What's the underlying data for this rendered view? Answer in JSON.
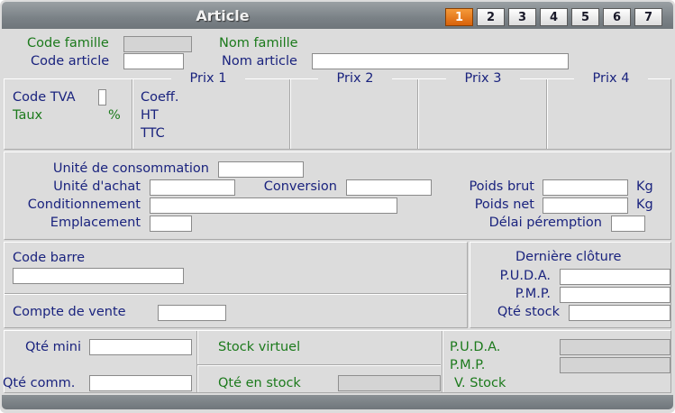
{
  "window": {
    "title": "Article"
  },
  "tabs": [
    "1",
    "2",
    "3",
    "4",
    "5",
    "6",
    "7"
  ],
  "header": {
    "code_famille": "Code famille",
    "nom_famille": "Nom famille",
    "code_article": "Code article",
    "nom_article": "Nom article"
  },
  "prix": {
    "headers": [
      "Prix 1",
      "Prix 2",
      "Prix 3",
      "Prix 4"
    ],
    "code_tva": "Code TVA",
    "taux": "Taux",
    "percent": "%",
    "coeff": "Coeff.",
    "ht": "HT",
    "ttc": "TTC"
  },
  "units": {
    "unite_consommation": "Unité de consommation",
    "unite_achat": "Unité d'achat",
    "conversion": "Conversion",
    "poids_brut": "Poids brut",
    "kg1": "Kg",
    "conditionnement": "Conditionnement",
    "poids_net": "Poids net",
    "kg2": "Kg",
    "emplacement": "Emplacement",
    "delai_peremption": "Délai péremption"
  },
  "codebarre": {
    "label": "Code barre",
    "compte_vente": "Compte de vente"
  },
  "cloture": {
    "title": "Dernière clôture",
    "puda": "P.U.D.A.",
    "pmp": "P.M.P.",
    "qte_stock": "Qté stock"
  },
  "stock": {
    "qte_mini": "Qté mini",
    "qte_comm": "Qté comm.",
    "stock_virtuel": "Stock virtuel",
    "qte_en_stock": "Qté en stock",
    "puda": "P.U.D.A.",
    "pmp": "P.M.P.",
    "v_stock": "V. Stock"
  },
  "colors": {
    "title_bar": "#7a8186",
    "active_tab": "#e87a1a",
    "label_blue": "#1a237e",
    "label_green": "#1c7a1c"
  }
}
